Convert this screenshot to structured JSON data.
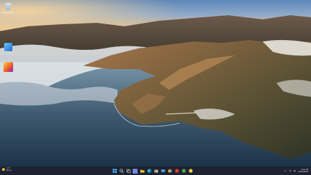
{
  "desktop": {
    "icons": [
      {
        "name": "recycle-bin",
        "label": "Recycle Bin"
      },
      {
        "name": "app-shortcut-blue",
        "label": ""
      },
      {
        "name": "app-shortcut-color",
        "label": ""
      }
    ]
  },
  "taskbar": {
    "weather": {
      "temp": "71°F",
      "condition": "Sunny"
    },
    "apps": [
      {
        "name": "start-icon",
        "color": "#3fa9f5"
      },
      {
        "name": "search-icon",
        "color": "#ffffff"
      },
      {
        "name": "task-view-icon",
        "color": "#ffffff"
      },
      {
        "name": "chat-icon",
        "color": "#7b83eb"
      },
      {
        "name": "file-explorer-icon",
        "color": "#f3c03a"
      },
      {
        "name": "edge-icon",
        "color": "#2fb5c9"
      },
      {
        "name": "store-icon",
        "color": "#ffffff"
      },
      {
        "name": "mail-icon",
        "color": "#3b8ee0"
      },
      {
        "name": "chrome-icon",
        "color": "#e04a3a"
      },
      {
        "name": "app-red-icon",
        "color": "#e53935"
      },
      {
        "name": "app-green-icon",
        "color": "#4caf50"
      },
      {
        "name": "app-yellow-icon",
        "color": "#f9d24a"
      }
    ],
    "clock": {
      "time": "8:31 PM",
      "date": "10/23/2023"
    }
  }
}
